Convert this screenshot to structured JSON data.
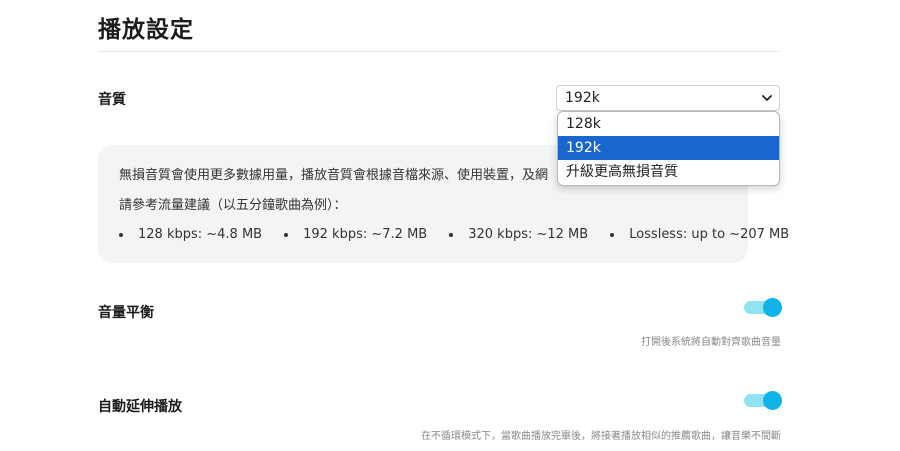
{
  "header": {
    "title": "播放設定"
  },
  "quality": {
    "label": "音質",
    "selected_value": "192k",
    "options": [
      "128k",
      "192k",
      "升級更高無損音質"
    ],
    "info": {
      "line1": "無損音質會使用更多數據用量，播放音質會根據音檔來源、使用裝置，及網",
      "line2": "請參考流量建議（以五分鐘歌曲為例）：",
      "bullets": [
        "128 kbps: ~4.8 MB",
        "192 kbps: ~7.2 MB",
        "320 kbps: ~12 MB",
        "Lossless: up to ~207 MB"
      ]
    }
  },
  "volume_balance": {
    "label": "音量平衡",
    "enabled": true,
    "hint": "打開後系統將自動對齊歌曲音量"
  },
  "autoplay": {
    "label": "自動延伸播放",
    "enabled": true,
    "hint": "在不循環模式下，當歌曲播放完畢後，將接著播放相似的推薦歌曲，讓音樂不間斷"
  },
  "colors": {
    "accent": "#10b4e8",
    "accent_light": "#8fe3f3",
    "selected_option": "#1a66cf"
  }
}
